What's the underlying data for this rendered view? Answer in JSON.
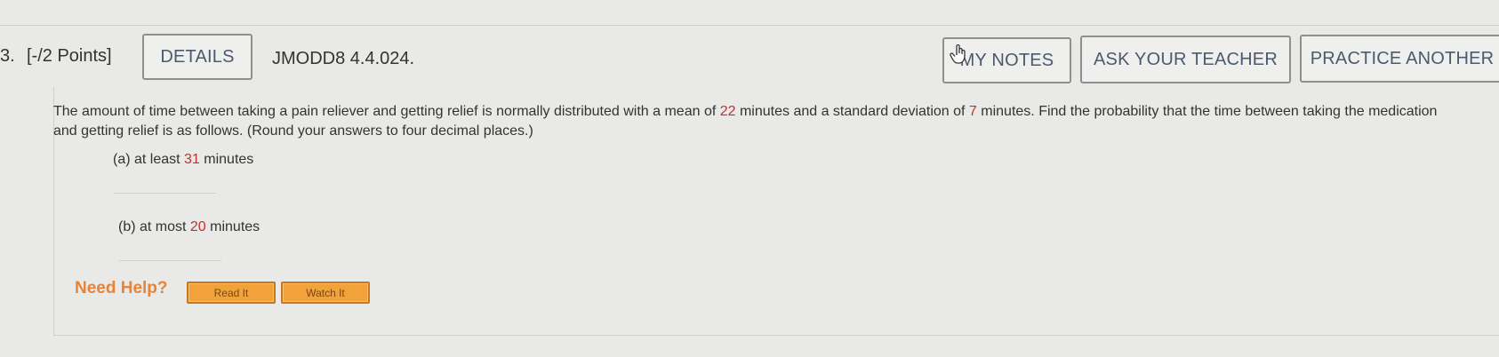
{
  "question": {
    "number": "3.",
    "points": "[-/2 Points]",
    "details_label": "DETAILS",
    "code": "JMODD8 4.4.024."
  },
  "actions": {
    "my_notes": "MY NOTES",
    "ask_teacher": "ASK YOUR TEACHER",
    "practice_another": "PRACTICE ANOTHER"
  },
  "problem": {
    "text_1": "The amount of time between taking a pain reliever and getting relief is normally distributed with a mean of ",
    "mean": "22",
    "text_2": " minutes and a standard deviation of ",
    "std": "7",
    "text_3": " minutes. Find the probability that the time between taking the medication and getting relief is as follows. (Round your answers to four decimal places.)",
    "part_a": {
      "prefix": "(a) at least ",
      "value": "31",
      "suffix": " minutes",
      "answer": ""
    },
    "part_b": {
      "prefix": "(b) at most ",
      "value": "20",
      "suffix": " minutes",
      "answer": ""
    }
  },
  "help": {
    "label": "Need Help?",
    "read_it": "Read It",
    "watch_it": "Watch It"
  },
  "colors": {
    "accent_red": "#c0312e",
    "help_orange": "#e8833a",
    "help_button": "#f2a23b"
  }
}
